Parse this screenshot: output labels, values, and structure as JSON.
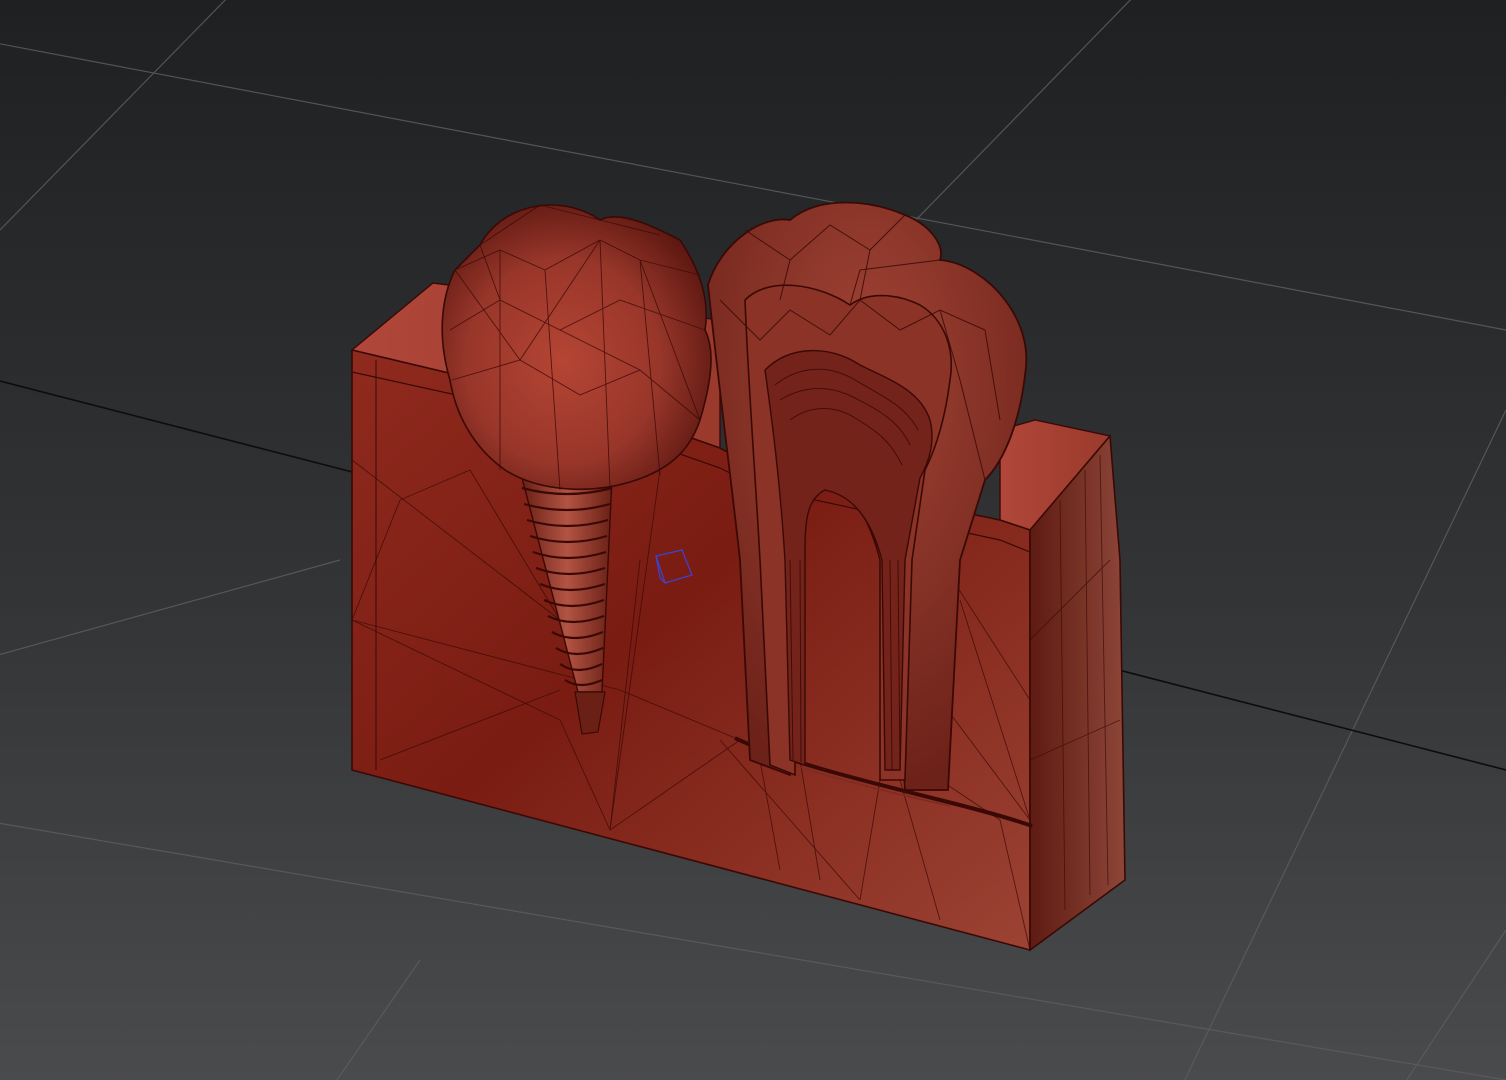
{
  "viewport": {
    "background_top": "#1f2022",
    "background_bottom": "#4a4b4d",
    "grid_color": "#6a6b6d",
    "home_grid_color": "#0b0b0b",
    "model_color": "#9b3a2a",
    "model_shadow": "#5a140c",
    "model_highlight": "#c95a4a",
    "wire_color": "#3a0906",
    "pivot_color": "#3a44d6"
  },
  "model": {
    "parts": [
      "jaw-block",
      "implant-crown",
      "implant-screw",
      "natural-molar-cross-section",
      "nerve-canal"
    ]
  }
}
